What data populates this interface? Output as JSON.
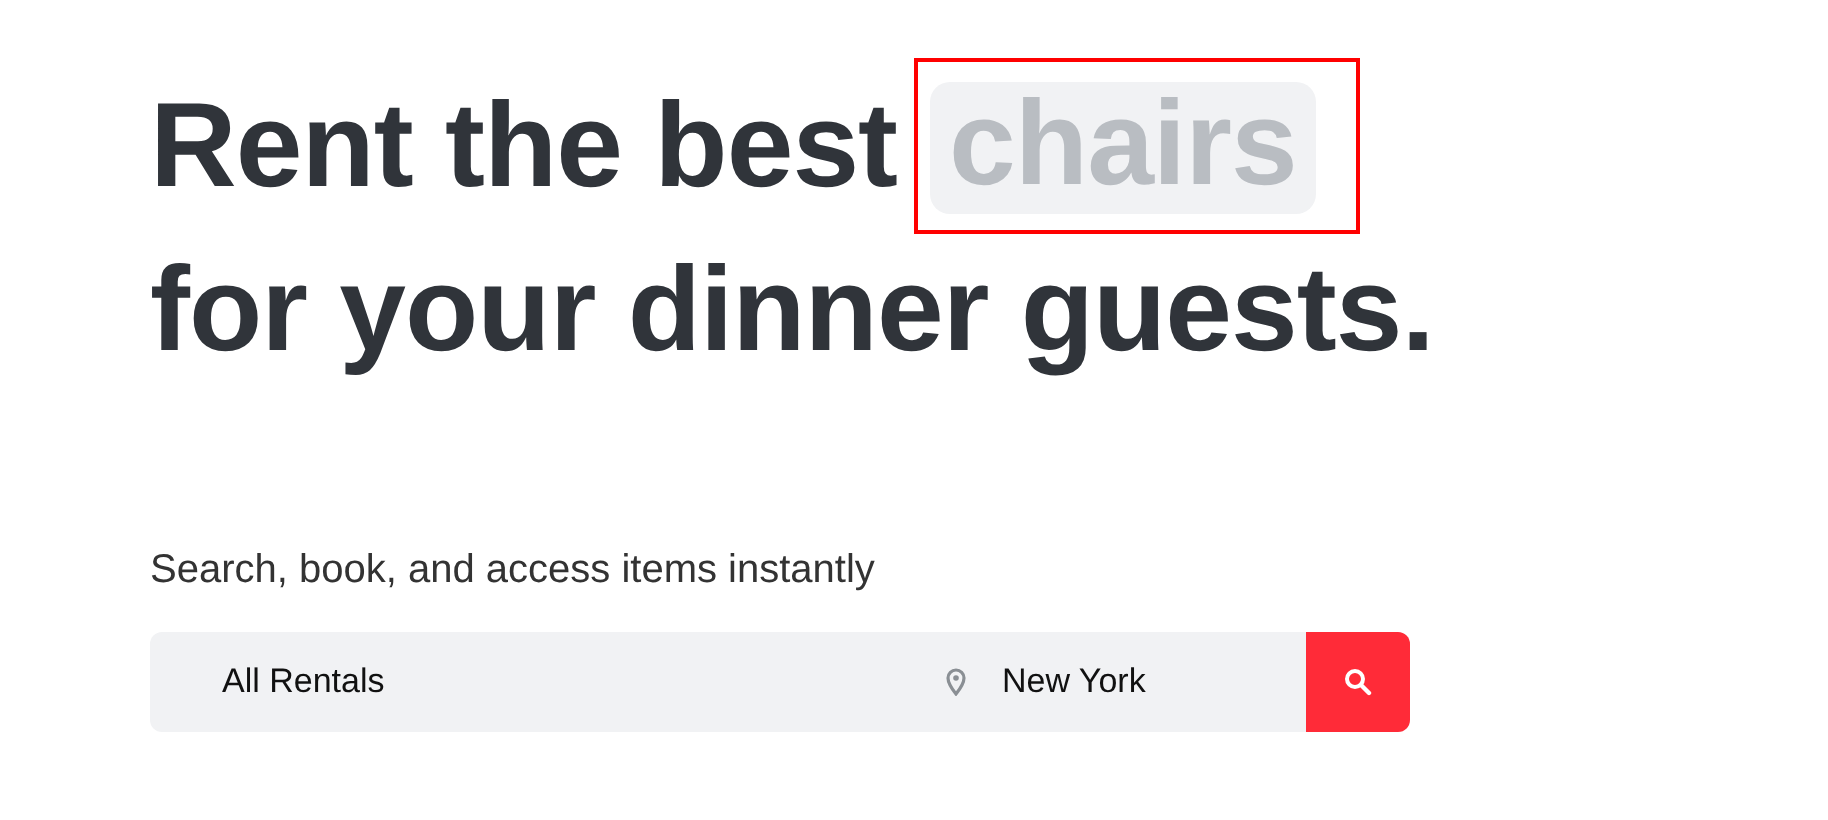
{
  "headline": {
    "line_1": "Rent the best",
    "highlight": "chairs",
    "line_2": "for your dinner guests."
  },
  "subtitle": "Search, book, and access items instantly",
  "search": {
    "category": "All Rentals",
    "location": "New York"
  }
}
